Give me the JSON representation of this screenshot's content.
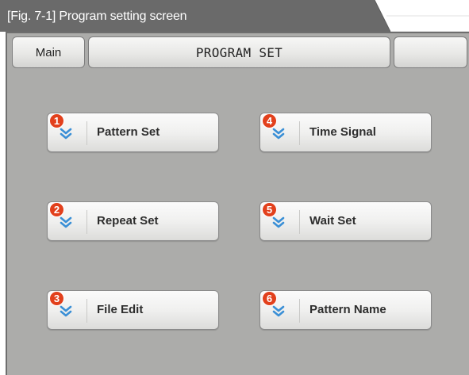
{
  "caption": "[Fig. 7-1] Program setting screen",
  "header": {
    "main_button": "Main",
    "title": "PROGRAM SET"
  },
  "menu": [
    {
      "number": "1",
      "label": "Pattern Set",
      "icon": "chevron-down-icon"
    },
    {
      "number": "4",
      "label": "Time Signal",
      "icon": "chevron-down-icon"
    },
    {
      "number": "2",
      "label": "Repeat Set",
      "icon": "chevron-down-icon"
    },
    {
      "number": "5",
      "label": "Wait Set",
      "icon": "chevron-down-icon"
    },
    {
      "number": "3",
      "label": "File Edit",
      "icon": "chevron-down-icon"
    },
    {
      "number": "6",
      "label": "Pattern Name",
      "icon": "chevron-down-icon"
    }
  ],
  "colors": {
    "caption_bg": "#6a6a6a",
    "panel_bg": "#acacaa",
    "badge": "#e2401c",
    "chevron": "#3a8fd6"
  }
}
